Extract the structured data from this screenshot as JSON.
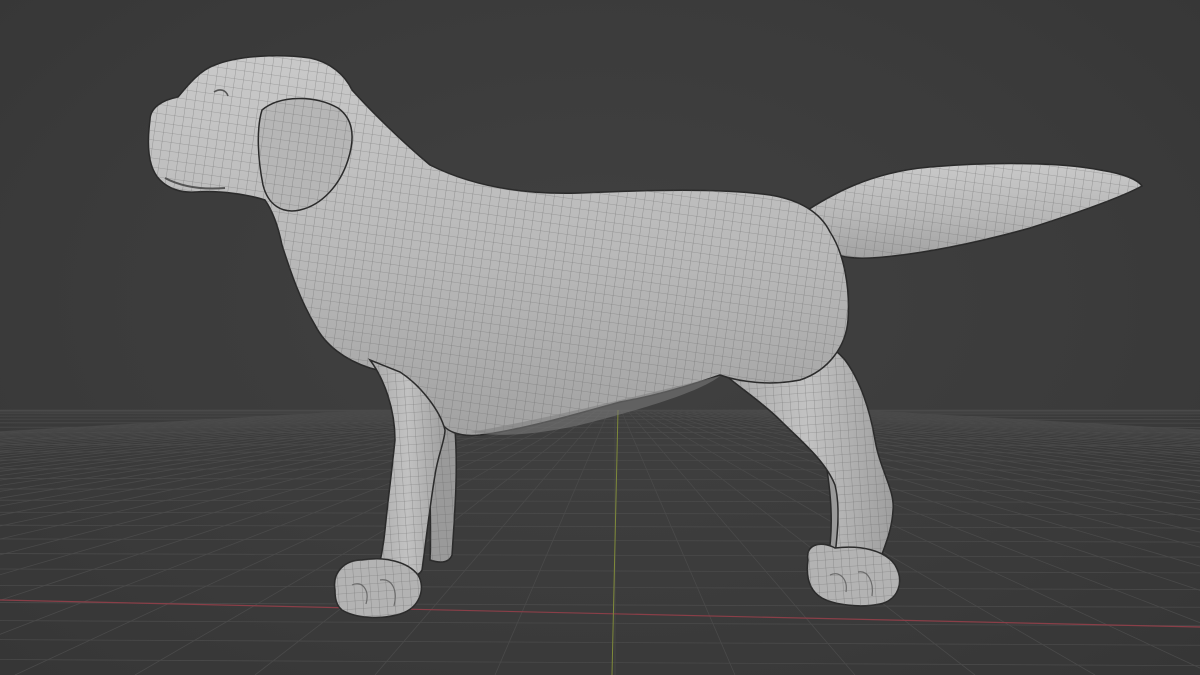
{
  "viewport": {
    "kind": "3d-viewport",
    "background_color": "#3d3d3d",
    "grid_line_color": "#4a4a4a",
    "x_axis_color": "#8a3f48",
    "y_axis_color": "#7f8a3a",
    "object": {
      "name": "dog-mesh",
      "shading": "solid-with-wireframe",
      "base_color": "#b9b9b9",
      "wire_color": "#5e5e5e",
      "outline_color": "#2a2a2a"
    }
  }
}
